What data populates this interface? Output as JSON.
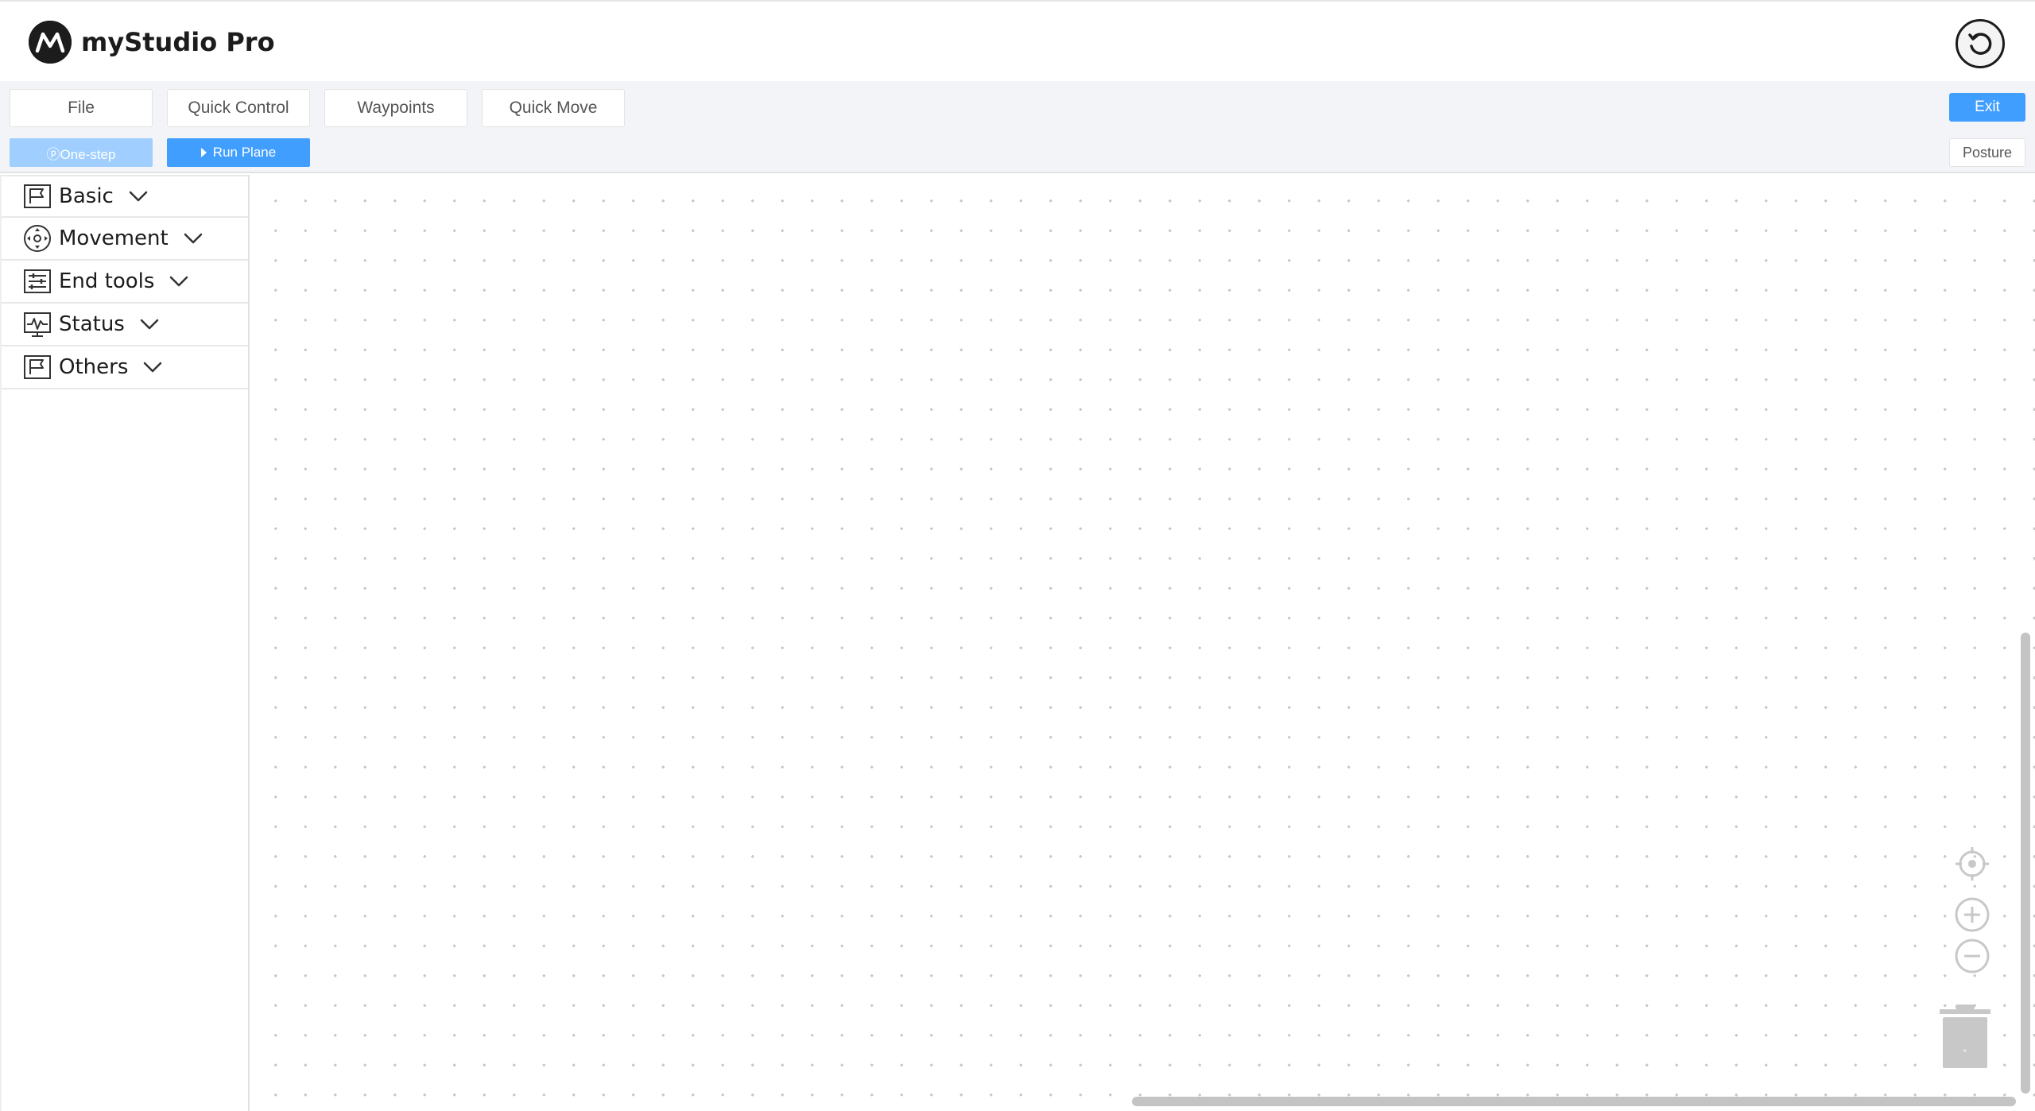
{
  "header": {
    "app_title": "myStudio Pro",
    "logo_icon": "mystudio-logo-icon",
    "undo_icon": "undo-icon"
  },
  "toolbar": {
    "menu": [
      {
        "label": "File"
      },
      {
        "label": "Quick Control"
      },
      {
        "label": "Waypoints"
      },
      {
        "label": "Quick Move"
      }
    ],
    "one_step_label": "ⓟOne-step",
    "run_plane_label": "Run Plane",
    "exit_label": "Exit",
    "posture_label": "Posture"
  },
  "sidebar": {
    "categories": [
      {
        "label": "Basic",
        "icon": "flag-frame-icon"
      },
      {
        "label": "Movement",
        "icon": "movement-dpad-icon"
      },
      {
        "label": "End tools",
        "icon": "sliders-panel-icon"
      },
      {
        "label": "Status",
        "icon": "monitor-pulse-icon"
      },
      {
        "label": "Others",
        "icon": "flag-frame-icon"
      }
    ]
  },
  "canvas": {
    "controls": [
      "locate-center-icon",
      "zoom-in-icon",
      "zoom-out-icon",
      "trash-icon"
    ]
  },
  "colors": {
    "primary": "#409eff",
    "primary_disabled": "#a0cfff",
    "toolbar_bg": "#f3f4f8",
    "grid_dot": "#c8c8c8"
  }
}
